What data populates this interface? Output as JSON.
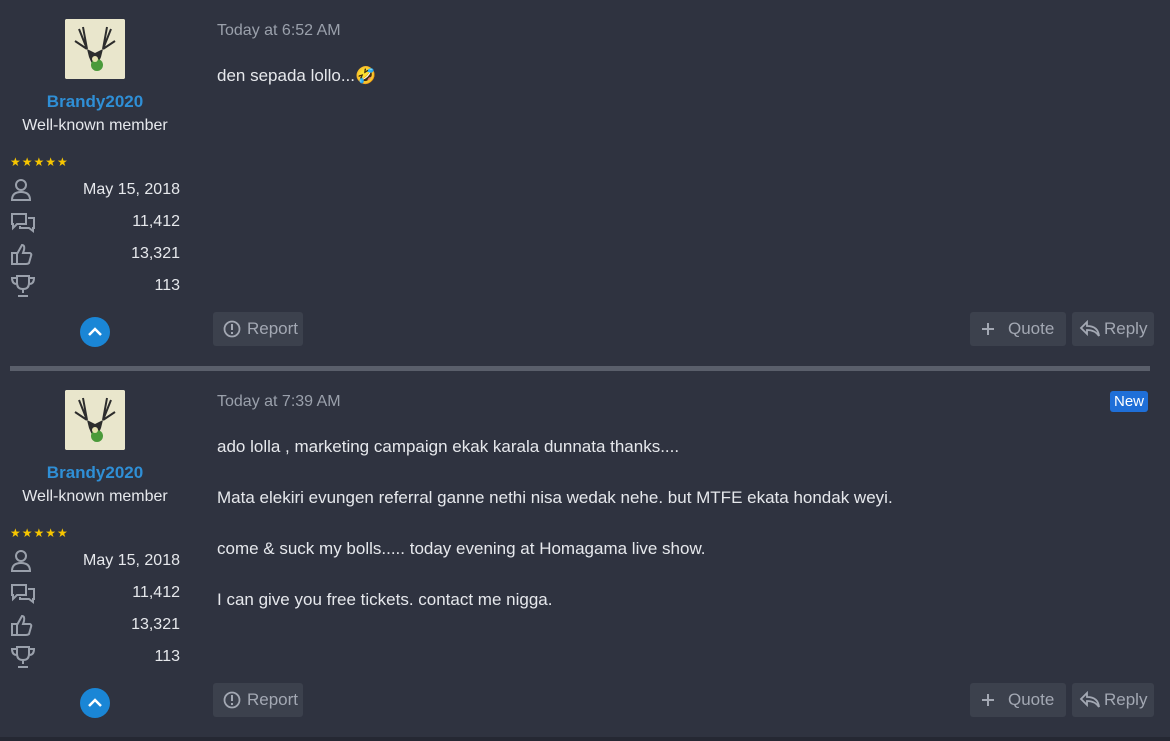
{
  "posts": [
    {
      "user": {
        "name": "Brandy2020",
        "title": "Well-known member",
        "stars": "★★★★★",
        "joined": "May 15, 2018",
        "messages": "11,412",
        "reactions": "13,321",
        "points": "113"
      },
      "time": "Today at 6:52 AM",
      "badge": "",
      "lines": [
        "den sepada lollo...🤣"
      ],
      "actions": {
        "report": "Report",
        "quote": "Quote",
        "reply": "Reply"
      }
    },
    {
      "user": {
        "name": "Brandy2020",
        "title": "Well-known member",
        "stars": "★★★★★",
        "joined": "May 15, 2018",
        "messages": "11,412",
        "reactions": "13,321",
        "points": "113"
      },
      "time": "Today at 7:39 AM",
      "badge": "New",
      "lines": [
        "ado lolla , marketing campaign ekak karala dunnata thanks....",
        "Mata elekiri evungen referral ganne nethi nisa wedak nehe. but MTFE ekata hondak weyi.",
        "come & suck my bolls..... today evening at Homagama live show.",
        "I can give you free tickets. contact me nigga."
      ],
      "actions": {
        "report": "Report",
        "quote": "Quote",
        "reply": "Reply"
      }
    }
  ],
  "colors": {
    "background": "#2f3340",
    "accent": "#2f8fd6",
    "badge": "#1f6fd8",
    "star": "#f7c600"
  },
  "icons": [
    "avatar-deer",
    "user-icon",
    "messages-icon",
    "thumbs-up-icon",
    "trophy-icon",
    "chevron-up-icon",
    "report-icon",
    "plus-icon",
    "reply-icon"
  ]
}
